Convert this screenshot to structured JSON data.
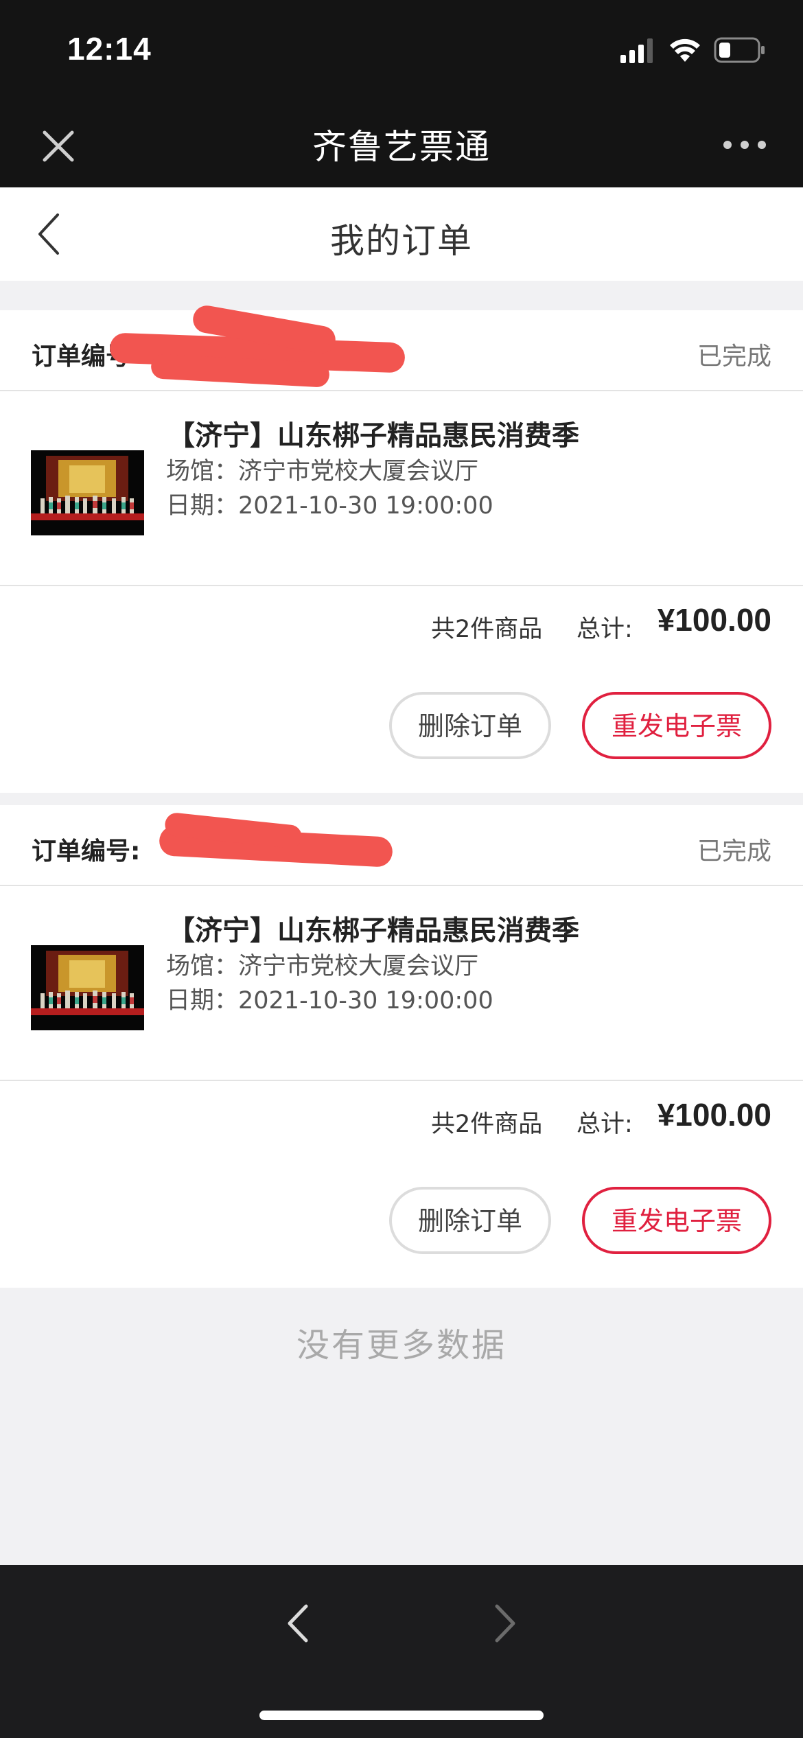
{
  "status_bar": {
    "time": "12:14",
    "icons": [
      "signal-icon",
      "wifi-icon",
      "battery-icon"
    ]
  },
  "wechat_bar": {
    "title": "齐鲁艺票通",
    "close_icon": "close-icon",
    "more_icon": "more-icon"
  },
  "header": {
    "title": "我的订单",
    "back_icon": "chevron-left-icon"
  },
  "orders": [
    {
      "order_no_label": "订单编号",
      "status": "已完成",
      "item": {
        "title": "【济宁】山东梆子精品惠民消费季",
        "venue": "场馆：济宁市党校大厦会议厅",
        "date": "日期：2021-10-30 19:00:00"
      },
      "count_text": "共2件商品",
      "total_label": "总计:",
      "total": "¥100.00",
      "delete_label": "删除订单",
      "resend_label": "重发电子票"
    },
    {
      "order_no_label": "订单编号:",
      "status": "已完成",
      "item": {
        "title": "【济宁】山东梆子精品惠民消费季",
        "venue": "场馆：济宁市党校大厦会议厅",
        "date": "日期：2021-10-30 19:00:00"
      },
      "count_text": "共2件商品",
      "total_label": "总计:",
      "total": "¥100.00",
      "delete_label": "删除订单",
      "resend_label": "重发电子票"
    }
  ],
  "footer": {
    "no_more": "没有更多数据"
  },
  "bottom_bar": {
    "back_icon": "chevron-left-icon",
    "forward_icon": "chevron-right-icon"
  },
  "colors": {
    "accent": "#e0203f",
    "page_bg": "#f1f1f3",
    "top_bar_bg": "#141414",
    "bottom_bar_bg": "#1c1c1e"
  }
}
